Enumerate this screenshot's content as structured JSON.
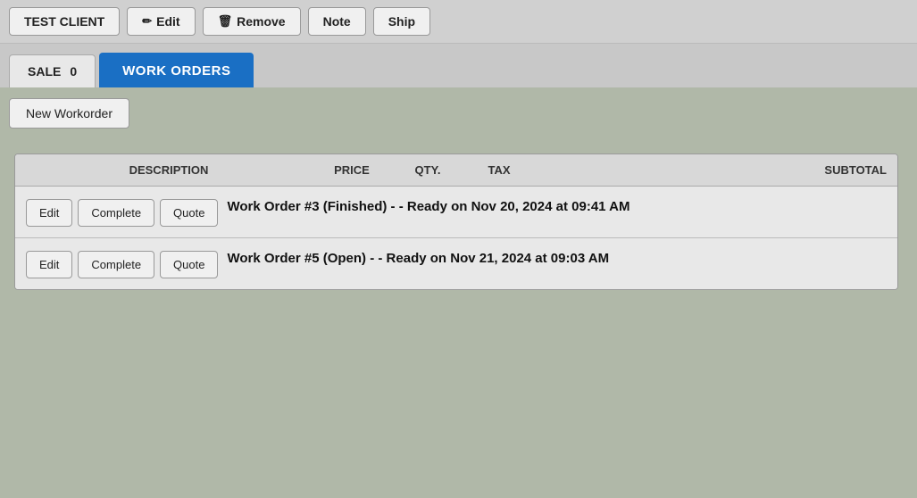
{
  "toolbar": {
    "client_label": "TEST CLIENT",
    "edit_label": "Edit",
    "remove_label": "Remove",
    "note_label": "Note",
    "ship_label": "Ship",
    "edit_icon": "✏",
    "remove_icon": "🗑"
  },
  "tabs": {
    "sale_label": "SALE",
    "sale_count": "0",
    "workorders_label": "WORK ORDERS"
  },
  "sub_toolbar": {
    "new_workorder_label": "New Workorder"
  },
  "table": {
    "headers": {
      "description": "DESCRIPTION",
      "price": "PRICE",
      "qty": "QTY.",
      "tax": "TAX",
      "subtotal": "SUBTOTAL"
    },
    "rows": [
      {
        "edit_label": "Edit",
        "complete_label": "Complete",
        "quote_label": "Quote",
        "description": "Work Order #3 (Finished) - - Ready on Nov 20, 2024 at 09:41 AM"
      },
      {
        "edit_label": "Edit",
        "complete_label": "Complete",
        "quote_label": "Quote",
        "description": "Work Order #5 (Open) - - Ready on Nov 21, 2024 at 09:03 AM"
      }
    ]
  }
}
